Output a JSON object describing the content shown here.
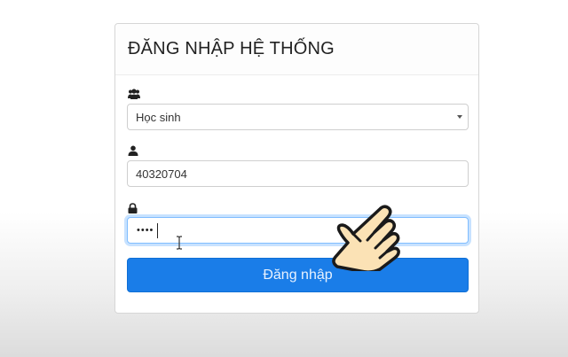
{
  "login": {
    "title": "ĐĂNG NHẬP HỆ THỐNG",
    "role": {
      "icon": "users-icon",
      "selected": "Học sinh"
    },
    "username": {
      "icon": "user-icon",
      "value": "40320704"
    },
    "password": {
      "icon": "lock-icon",
      "masked_value": "••••"
    },
    "submit_label": "Đăng nhập"
  },
  "colors": {
    "primary": "#1a7de8",
    "focus_border": "#80bdff",
    "hand_skin": "#fbe2b5"
  },
  "overlay": {
    "text_cursor_icon": "ibeam-cursor-icon",
    "pointer_icon": "hand-pointer-icon"
  }
}
